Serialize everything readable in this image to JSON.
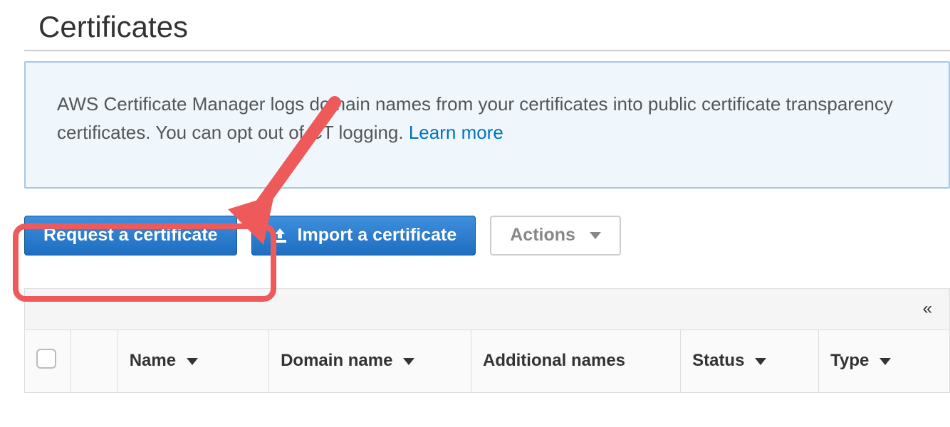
{
  "page": {
    "title": "Certificates"
  },
  "banner": {
    "text_before_link": "AWS Certificate Manager logs domain names from your certificates into public certificate transparency certificates. You can opt out of CT logging. ",
    "link_text": "Learn more"
  },
  "buttons": {
    "request_label": "Request a certificate",
    "import_label": "Import a certificate",
    "actions_label": "Actions"
  },
  "icons": {
    "upload": "upload-icon",
    "caret_down": "caret-down-icon",
    "collapse": "collapse-icon"
  },
  "table": {
    "columns": {
      "name": "Name",
      "domain_name": "Domain name",
      "additional_names": "Additional names",
      "status": "Status",
      "type": "Type"
    }
  },
  "annotation": {
    "highlighted_button": "request-certificate-button"
  }
}
